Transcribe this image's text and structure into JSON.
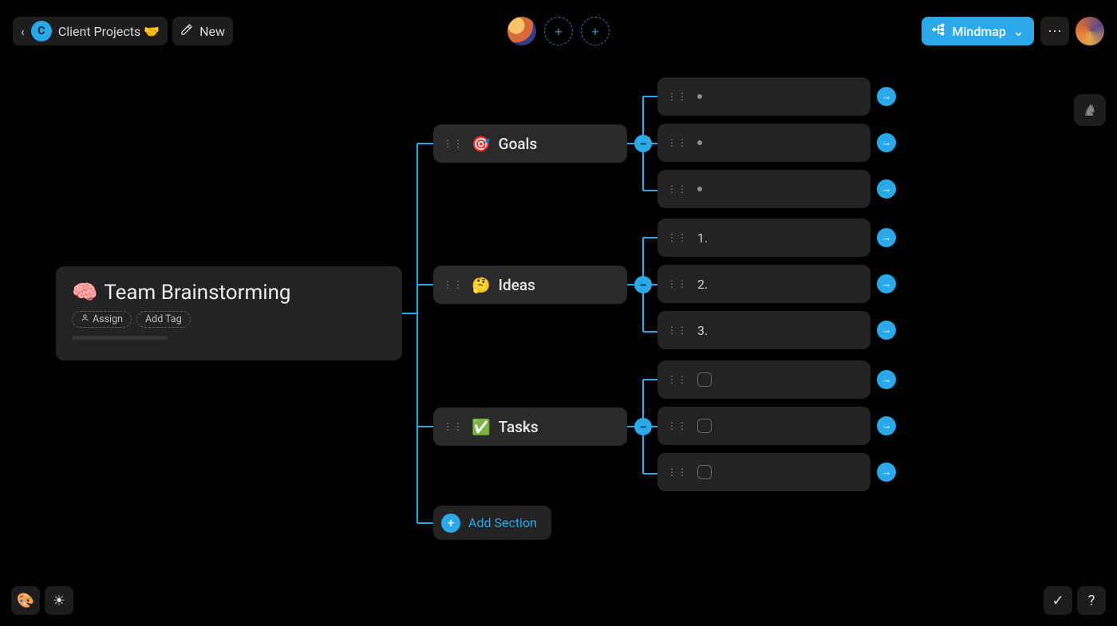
{
  "header": {
    "workspace_initial": "C",
    "breadcrumb": "Client Projects 🤝",
    "new_label": "New",
    "view_button": "Mindmap"
  },
  "root": {
    "emoji": "🧠",
    "title": "Team Brainstorming",
    "assign_label": "Assign",
    "add_tag_label": "Add Tag"
  },
  "sections": [
    {
      "emoji": "🎯",
      "label": "Goals",
      "leaf_type": "bullet",
      "leaves": [
        "",
        "",
        ""
      ]
    },
    {
      "emoji": "🤔",
      "label": "Ideas",
      "leaf_type": "number",
      "leaves": [
        "1.",
        "2.",
        "3."
      ]
    },
    {
      "emoji": "✅",
      "label": "Tasks",
      "leaf_type": "checkbox",
      "leaves": [
        "",
        "",
        ""
      ]
    }
  ],
  "add_section_label": "Add Section",
  "icons": {
    "back": "‹",
    "new": "✎",
    "plus": "+",
    "more": "⋯",
    "chevron_down": "⌄",
    "arrow_right": "→",
    "minus": "−",
    "palette": "🎨",
    "sun": "☀",
    "check": "✓",
    "help": "?",
    "person": "⍟"
  },
  "colors": {
    "accent": "#2ba8e8"
  }
}
